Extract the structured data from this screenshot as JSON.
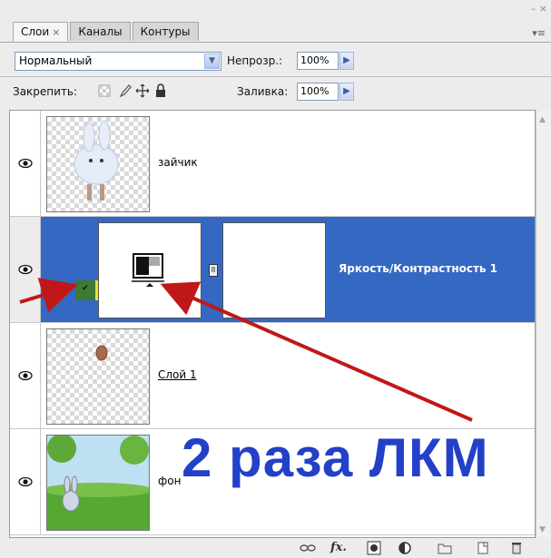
{
  "tabs": [
    {
      "label": "Слои",
      "active": true,
      "close": "×"
    },
    {
      "label": "Каналы",
      "active": false
    },
    {
      "label": "Контуры",
      "active": false
    }
  ],
  "window": {
    "minimize": "–",
    "close": "×",
    "menu": "▾≡"
  },
  "blend": {
    "value": "Нормальный"
  },
  "opacity": {
    "label": "Непрозр.:",
    "value": "100%"
  },
  "lock": {
    "label": "Закрепить:"
  },
  "fill": {
    "label": "Заливка:",
    "value": "100%"
  },
  "layers": [
    {
      "name": "зайчик",
      "visible": true,
      "selected": false
    },
    {
      "name": "Яркость/Контрастность 1",
      "visible": true,
      "selected": true
    },
    {
      "name": "Слой 1",
      "visible": true,
      "selected": false
    },
    {
      "name": "фон",
      "visible": true,
      "selected": false
    }
  ],
  "annotation": {
    "text": "2 раза ЛКМ",
    "color": "#2340c8",
    "arrow_color": "#c01818"
  },
  "colors": {
    "selected_row": "#3468c3",
    "panel": "#ececec"
  },
  "toolbar_icons": [
    "link-icon",
    "fx-icon",
    "mask-icon",
    "adjustment-icon",
    "folder-icon",
    "new-layer-icon",
    "trash-icon"
  ]
}
